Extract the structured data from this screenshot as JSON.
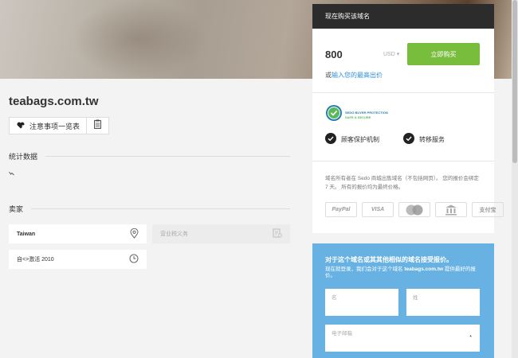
{
  "domain": "teabags.com.tw",
  "actions": {
    "watchlist_label": "注意事项一览表"
  },
  "sections": {
    "stats_title": "统计数据",
    "seller_title": "卖家"
  },
  "seller": {
    "country": "Taiwan",
    "vat_placeholder": "营业税义务",
    "active_since": "自<>激活 2010"
  },
  "buy": {
    "header": "现在购买该域名",
    "price": "800",
    "currency": "USD",
    "buy_button": "立即购买",
    "or_text": "或",
    "offer_link": "输入您的最高出价",
    "badge_line1": "SEDO BUYER PROTECTION",
    "badge_line2": "SAFE & SECURE",
    "feature_1": "顾客保护机制",
    "feature_2": "转移服务",
    "disclaimer": "域名所有者在 Sedo 商城出售域名（不包括网页）。 您的报价会绑定 7 天。 所有的报价均为最终价格。",
    "payment_methods": [
      "PayPal",
      "VISA",
      "MasterCard",
      "bank-icon",
      "支付宝"
    ]
  },
  "offer_form": {
    "title": "对于这个域名或其其他相似的域名接受报价。",
    "subtitle_prefix": "现在就登录，我们会对于这个域名",
    "subtitle_domain": "teabags.com.tw",
    "subtitle_suffix": "提供最好的报价。",
    "first_name_placeholder": "名",
    "last_name_placeholder": "姓",
    "email_placeholder": "电子邮箱",
    "required_mark": "*"
  },
  "colors": {
    "buy_button": "#79bd3c",
    "offer_panel": "#67b2e2",
    "link": "#2b8fd5",
    "header_dark": "#2c2c2c"
  }
}
